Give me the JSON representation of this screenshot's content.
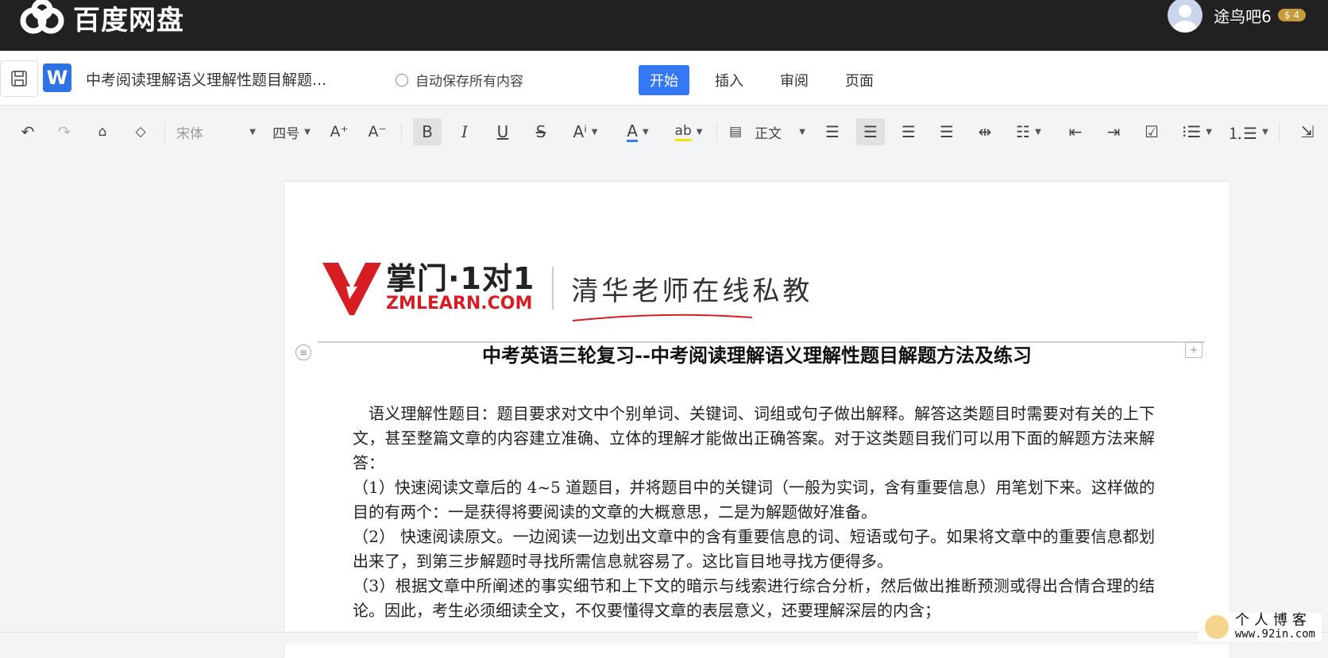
{
  "app": {
    "title": "百度网盘"
  },
  "user": {
    "name": "途鸟吧6",
    "vip": "4"
  },
  "doc": {
    "name": "中考阅读理解语义理解性题目解题...",
    "autosave": "自动保存所有内容"
  },
  "tabs": [
    {
      "label": "开始",
      "active": true
    },
    {
      "label": "插入"
    },
    {
      "label": "审阅"
    },
    {
      "label": "页面"
    }
  ],
  "toolbar": {
    "font": "宋体",
    "size": "四号",
    "style": "正文"
  },
  "brand": {
    "name": "掌门·1对1",
    "site": "ZMLEARN.COM",
    "slogan": "清华老师在线私教"
  },
  "content": {
    "title": "中考英语三轮复习--中考阅读理解语义理解性题目解题方法及练习",
    "paragraphs": [
      "语义理解性题目：题目要求对文中个别单词、关键词、词组或句子做出解释。解答这类题目时需要对有关的上下文，甚至整篇文章的内容建立准确、立体的理解才能做出正确答案。对于这类题目我们可以用下面的解题方法来解答：",
      "（1）快速阅读文章后的 4~5 道题目，并将题目中的关键词（一般为实词，含有重要信息）用笔划下来。这样做的目的有两个：一是获得将要阅读的文章的大概意思，二是为解题做好准备。",
      "（2） 快速阅读原文。一边阅读一边划出文章中的含有重要信息的词、短语或句子。如果将文章中的重要信息都划出来了，到第三步解题时寻找所需信息就容易了。这比盲目地寻找方便得多。",
      "（3）根据文章中所阐述的事实细节和上下文的暗示与线索进行综合分析，然后做出推断预测或得出合情合理的结论。因此，考生必须细读全文，不仅要懂得文章的表层意义，还要理解深层的内含；"
    ]
  },
  "watermark": {
    "line1": "个人博客",
    "line2": "www.92in.com"
  },
  "colors": {
    "topbar": "#212121",
    "accent": "#3478f6",
    "brand_red": "#d71d24"
  }
}
